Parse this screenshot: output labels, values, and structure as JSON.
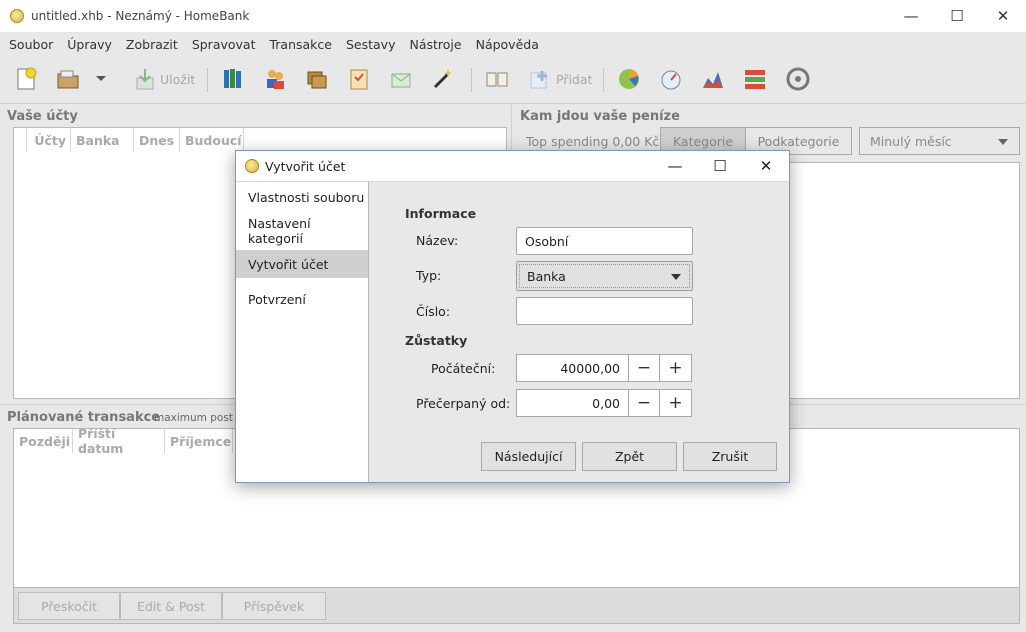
{
  "window": {
    "title": "untitled.xhb - Neznámý - HomeBank",
    "minimize": "—",
    "maximize": "☐",
    "close": "✕"
  },
  "menu": [
    "Soubor",
    "Úpravy",
    "Zobrazit",
    "Spravovat",
    "Transakce",
    "Sestavy",
    "Nástroje",
    "Nápověda"
  ],
  "toolbar": {
    "save_label": "Uložit",
    "add_label": "Přidat"
  },
  "accounts": {
    "title": "Vaše účty",
    "columns": [
      "Účty",
      "Banka",
      "Dnes",
      "Budoucí"
    ]
  },
  "spending": {
    "title": "Kam jdou vaše peníze",
    "top_spending_label": "Top spending",
    "top_spending_value": "0,00 Kč",
    "tab_category": "Kategorie",
    "tab_subcategory": "Podkategorie",
    "period": "Minulý měsíc"
  },
  "scheduled": {
    "title": "Plánované transakce",
    "hint": "maximum post da",
    "columns": [
      "Později",
      "Příští datum",
      "Příjemce"
    ],
    "skip_label": "Přeskočit",
    "edit_post_label": "Edit & Post",
    "post_label": "Příspěvek"
  },
  "dialog": {
    "title": "Vytvořit účet",
    "minimize": "—",
    "maximize": "☐",
    "close": "✕",
    "steps": [
      "Vlastnosti souboru",
      "Nastavení kategorií",
      "Vytvořit účet",
      "Potvrzení"
    ],
    "selected_step": "Vytvořit účet",
    "info_heading": "Informace",
    "name_label": "Název:",
    "name_value": "Osobní",
    "type_label": "Typ:",
    "type_value": "Banka",
    "number_label": "Číslo:",
    "number_value": "",
    "balances_heading": "Zůstatky",
    "initial_label": "Počáteční:",
    "initial_value": "40000,00",
    "overdraft_label": "Přečerpaný od:",
    "overdraft_value": "0,00",
    "minus": "−",
    "plus": "+",
    "next_label": "Následující",
    "back_label": "Zpět",
    "cancel_label": "Zrušit"
  }
}
